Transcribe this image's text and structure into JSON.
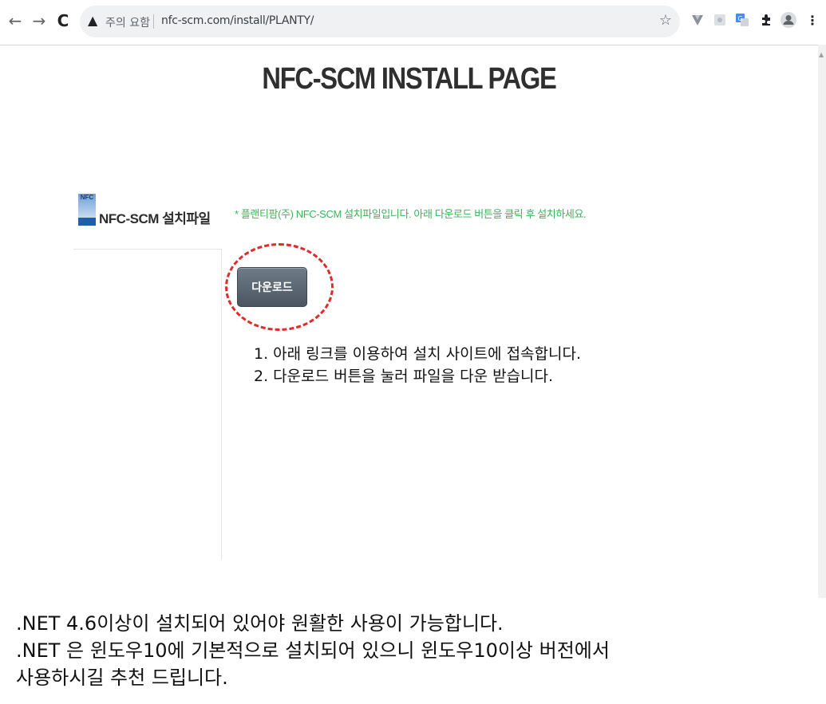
{
  "browser": {
    "back_glyph": "←",
    "forward_glyph": "→",
    "reload_glyph": "C",
    "security_label": "주의 요함",
    "url": "nfc-scm.com/install/PLANTY/",
    "icons": [
      "back-icon",
      "forward-icon",
      "reload-icon",
      "warning-icon",
      "star-icon",
      "vuetify-extension-icon",
      "puzzle-extension-icon",
      "translate-extension-icon",
      "extensions-icon",
      "profile-icon",
      "menu-icon"
    ]
  },
  "page": {
    "title": "NFC-SCM INSTALL PAGE",
    "logo_text": "NFC",
    "sidebar_title": "NFC-SCM 설치파일",
    "notice": "* 플랜티팜(주) NFC-SCM 설치파일입니다. 아래 다운로드 버튼을 클릭 후 설치하세요.",
    "download_button": "다운로드",
    "steps": [
      "1. 아래 링크를 이용하여 설치 사이트에 접속합니다.",
      "2. 다운로드 버튼을 눌러 파일을 다운 받습니다."
    ]
  },
  "footer": {
    "lines": [
      ".NET 4.6이상이 설치되어 있어야 원활한 사용이 가능합니다.",
      ".NET 은 윈도우10에 기본적으로 설치되어 있으니 윈도우10이상 버전에서",
      "사용하시길 추천 드립니다."
    ]
  },
  "colors": {
    "notice_green": "#3cb45a",
    "highlight_red": "#e02b2b",
    "button_gray": "#5a6672"
  }
}
